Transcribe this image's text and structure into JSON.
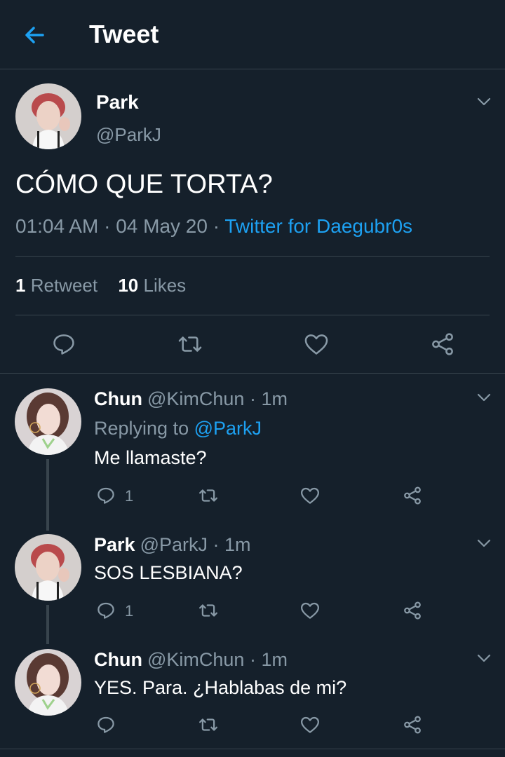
{
  "header": {
    "title": "Tweet"
  },
  "main_tweet": {
    "name": "Park",
    "handle": "@ParkJ",
    "text": "CÓMO QUE TORTA?",
    "time": "01:04 AM",
    "date": "04 May 20",
    "source": "Twitter for Daegubr0s",
    "retweets": {
      "count": "1",
      "label": "Retweet"
    },
    "likes": {
      "count": "10",
      "label": "Likes"
    }
  },
  "replies": [
    {
      "name": "Chun",
      "handle": "@KimChun",
      "time": "1m",
      "replying_label": "Replying to",
      "replying_to": "@ParkJ",
      "text": "Me llamaste?",
      "reply_count": "1"
    },
    {
      "name": "Park",
      "handle": "@ParkJ",
      "time": "1m",
      "text": "SOS LESBIANA?",
      "reply_count": "1"
    },
    {
      "name": "Chun",
      "handle": "@KimChun",
      "time": "1m",
      "text": "YES. Para. ¿Hablabas de mi?"
    }
  ],
  "separators": {
    "dot": "·"
  },
  "colors": {
    "background": "#15202b",
    "accent": "#1da1f2",
    "secondary_text": "#8899a6",
    "border": "#38444d"
  },
  "icons": [
    "back-arrow-icon",
    "chevron-down-icon",
    "reply-icon",
    "retweet-icon",
    "like-icon",
    "share-icon"
  ]
}
